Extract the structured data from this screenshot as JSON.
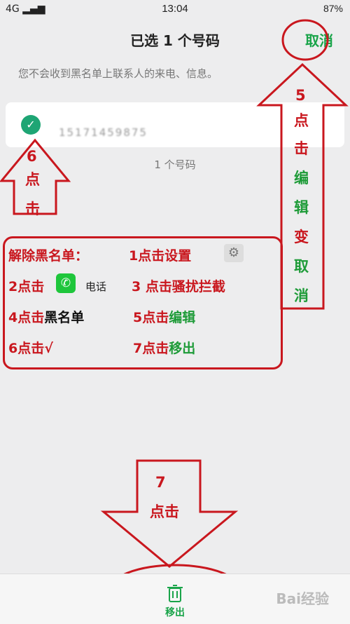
{
  "status": {
    "signal": "4G ▂▄▆",
    "time": "13:04",
    "battery": "87%"
  },
  "header": {
    "title": "已选 1 个号码",
    "cancel": "取消"
  },
  "notice": "您不会收到黑名单上联系人的来电、信息。",
  "contact": {
    "number": "15171459875"
  },
  "count": "1 个号码",
  "bottom": {
    "remove": "移出"
  },
  "annotations": {
    "step6": [
      "6",
      "点",
      "击"
    ],
    "step5": [
      "5",
      "点",
      "击",
      "编",
      "辑",
      "变",
      "取",
      "消"
    ],
    "step7": [
      "7",
      "点击"
    ],
    "guide": {
      "title": "解除黑名单：",
      "s1": "1点击设置",
      "s2a": "2点击",
      "s2b": "电话",
      "s3": "3 点击骚扰拦截",
      "s4a": "4点击",
      "s4b": "黑名单",
      "s5a": "5点击",
      "s5b": "编辑",
      "s6": "6点击√",
      "s7a": "7点击",
      "s7b": "移出"
    }
  },
  "watermark": "Bai经验"
}
